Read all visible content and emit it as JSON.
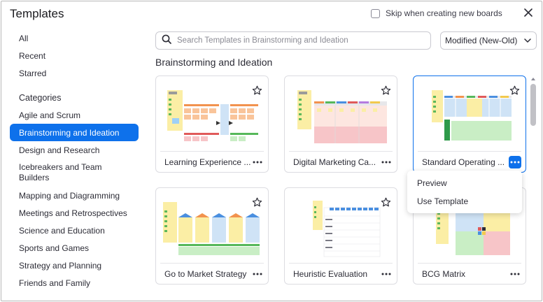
{
  "dialog": {
    "title": "Templates",
    "skip_label": "Skip when creating new boards",
    "skip_checked": false
  },
  "sidebar": {
    "top_items": [
      {
        "label": "All"
      },
      {
        "label": "Recent"
      },
      {
        "label": "Starred"
      }
    ],
    "categories_heading": "Categories",
    "categories": [
      {
        "label": "Agile and Scrum"
      },
      {
        "label": "Brainstorming and Ideation",
        "active": true
      },
      {
        "label": "Design and Research"
      },
      {
        "label": "Icebreakers and Team Builders"
      },
      {
        "label": "Mapping and Diagramming"
      },
      {
        "label": "Meetings and Retrospectives"
      },
      {
        "label": "Science and Education"
      },
      {
        "label": "Sports and Games"
      },
      {
        "label": "Strategy and Planning"
      },
      {
        "label": "Friends and Family"
      }
    ]
  },
  "search": {
    "placeholder": "Search Templates in Brainstorming and Ideation",
    "value": ""
  },
  "sort": {
    "selected": "Modified (New-Old)"
  },
  "section": {
    "title": "Brainstorming and Ideation"
  },
  "cards": [
    {
      "title": "Learning Experience ..."
    },
    {
      "title": "Digital Marketing Ca..."
    },
    {
      "title": "Standard Operating ..."
    },
    {
      "title": "Go to Market Strategy"
    },
    {
      "title": "Heuristic Evaluation"
    },
    {
      "title": "BCG Matrix"
    }
  ],
  "context_menu": {
    "items": [
      {
        "label": "Preview"
      },
      {
        "label": "Use Template"
      }
    ]
  },
  "colors": {
    "accent": "#0e71eb",
    "sticky_yellow": "#fbeea5",
    "sticky_orange": "#f9c49a",
    "sticky_pink": "#f7c5c8",
    "sticky_blue": "#cfe3f6",
    "sticky_green": "#c9eec5"
  }
}
